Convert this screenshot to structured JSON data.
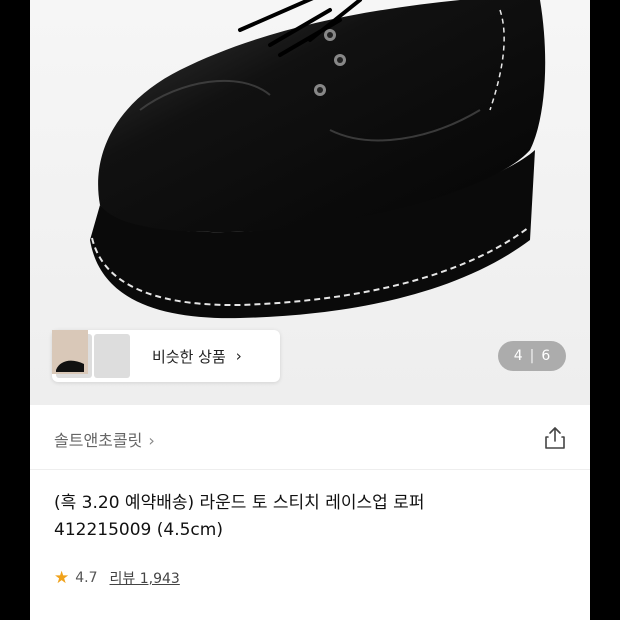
{
  "product_gallery": {
    "similar_products_label": "비슷한 상품",
    "chevron": "›",
    "counter_current": "4",
    "counter_separator": "|",
    "counter_total": "6"
  },
  "brand": {
    "name": "솔트앤초콜릿",
    "chevron": "›",
    "share_icon": "share-icon"
  },
  "product": {
    "title_line1": "(흑 3.20 예약배송) 라운드 토 스티치 레이스업 로퍼",
    "title_line2": "412215009 (4.5cm)",
    "rating": "4.7",
    "reviews_label": "리뷰 1,943"
  },
  "colors": {
    "star": "#f0a21b",
    "background": "#ffffff"
  }
}
